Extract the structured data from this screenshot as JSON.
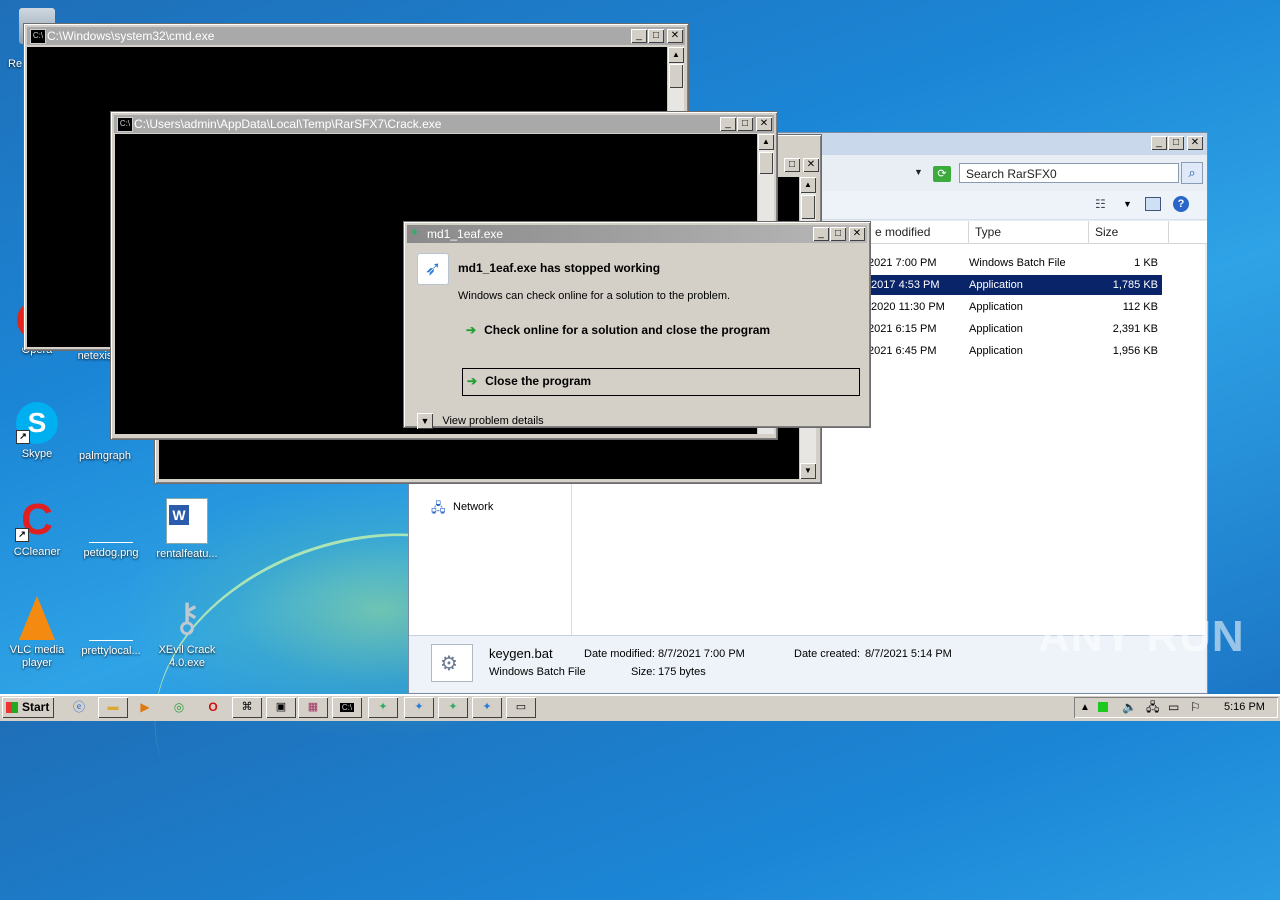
{
  "desktop": {
    "icons": [
      {
        "label": "Re"
      },
      {
        "label": "Opera"
      },
      {
        "label": "netexis"
      },
      {
        "label": "Skype"
      },
      {
        "label": "palmgraph"
      },
      {
        "label": "CCleaner"
      },
      {
        "label": "petdog.png"
      },
      {
        "label": "rentalfeatu..."
      },
      {
        "label": "VLC media player"
      },
      {
        "label": "prettylocal..."
      },
      {
        "label": "XEvil Crack 4.0.exe"
      }
    ]
  },
  "cmd_window": {
    "title": "C:\\Windows\\system32\\cmd.exe"
  },
  "crack_window": {
    "title": "C:\\Users\\admin\\AppData\\Local\\Temp\\RarSFX7\\Crack.exe"
  },
  "explorer": {
    "search_placeholder": "Search RarSFX0",
    "columns": [
      "e modified",
      "Type",
      "Size"
    ],
    "rows": [
      {
        "date": "2021 7:00 PM",
        "type": "Windows Batch File",
        "size": "1 KB",
        "selected": false
      },
      {
        "date": "/2017 4:53 PM",
        "type": "Application",
        "size": "1,785 KB",
        "selected": true
      },
      {
        "date": "/2020 11:30 PM",
        "type": "Application",
        "size": "112 KB",
        "selected": false
      },
      {
        "date": "2021 6:15 PM",
        "type": "Application",
        "size": "2,391 KB",
        "selected": false
      },
      {
        "date": "2021 6:45 PM",
        "type": "Application",
        "size": "1,956 KB",
        "selected": false
      }
    ],
    "nav_network": "Network",
    "details": {
      "name": "keygen.bat",
      "type": "Windows Batch File",
      "date_modified_label": "Date modified:",
      "date_modified": "8/7/2021 7:00 PM",
      "date_created_label": "Date created:",
      "date_created": "8/7/2021 5:14 PM",
      "size_label": "Size:",
      "size": "175 bytes"
    }
  },
  "dialog": {
    "title": "md1_1eaf.exe",
    "heading": "md1_1eaf.exe has stopped working",
    "message": "Windows can check online for a solution to the problem.",
    "option_check": "Check online for a solution and close the program",
    "option_close": "Close the program",
    "details": "View problem details"
  },
  "taskbar": {
    "start": "Start",
    "clock": "5:16 PM"
  },
  "watermark": "ANY RUN",
  "colors": {
    "selection": "#0a246a",
    "console_bg": "#000000",
    "window_face": "#d4d0c8"
  }
}
